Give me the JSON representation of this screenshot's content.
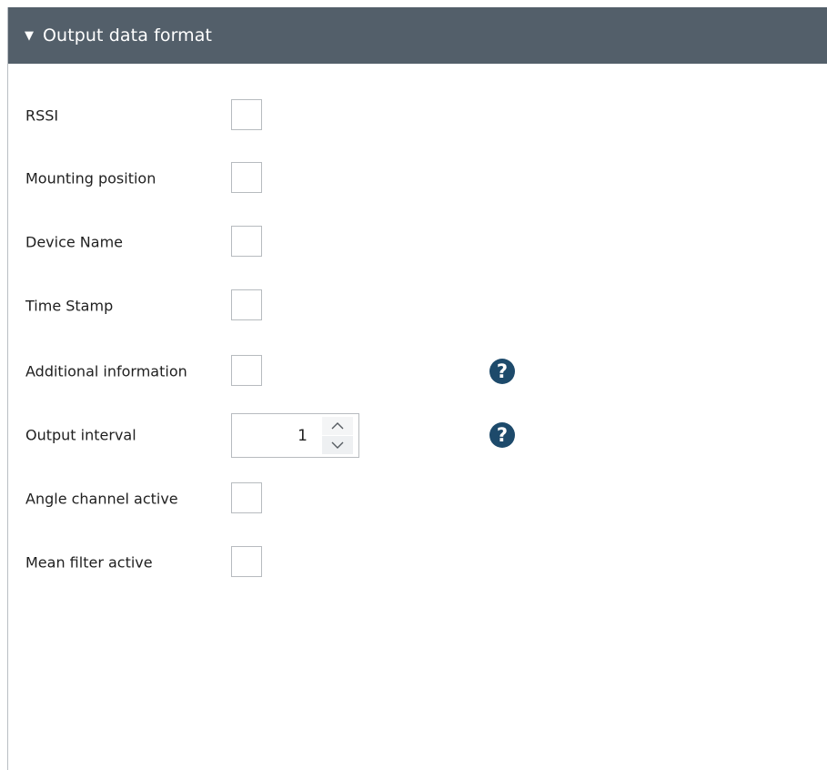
{
  "section": {
    "title": "Output data format",
    "expanded_icon": "triangle-down-icon"
  },
  "fields": {
    "rssi": {
      "label": "RSSI",
      "checked": false
    },
    "mounting_position": {
      "label": "Mounting position",
      "checked": false
    },
    "device_name": {
      "label": "Device Name",
      "checked": false
    },
    "time_stamp": {
      "label": "Time Stamp",
      "checked": false
    },
    "additional_information": {
      "label": "Additional information",
      "checked": false,
      "help_icon": "question-icon"
    },
    "output_interval": {
      "label": "Output interval",
      "value": "1",
      "help_icon": "question-icon"
    },
    "angle_channel_active": {
      "label": "Angle channel active",
      "checked": false
    },
    "mean_filter_active": {
      "label": "Mean filter active",
      "checked": false
    }
  },
  "colors": {
    "header_bg": "#535f6a",
    "help_icon": "#1d4a6b",
    "checkbox_border": "#b7bbbf"
  }
}
